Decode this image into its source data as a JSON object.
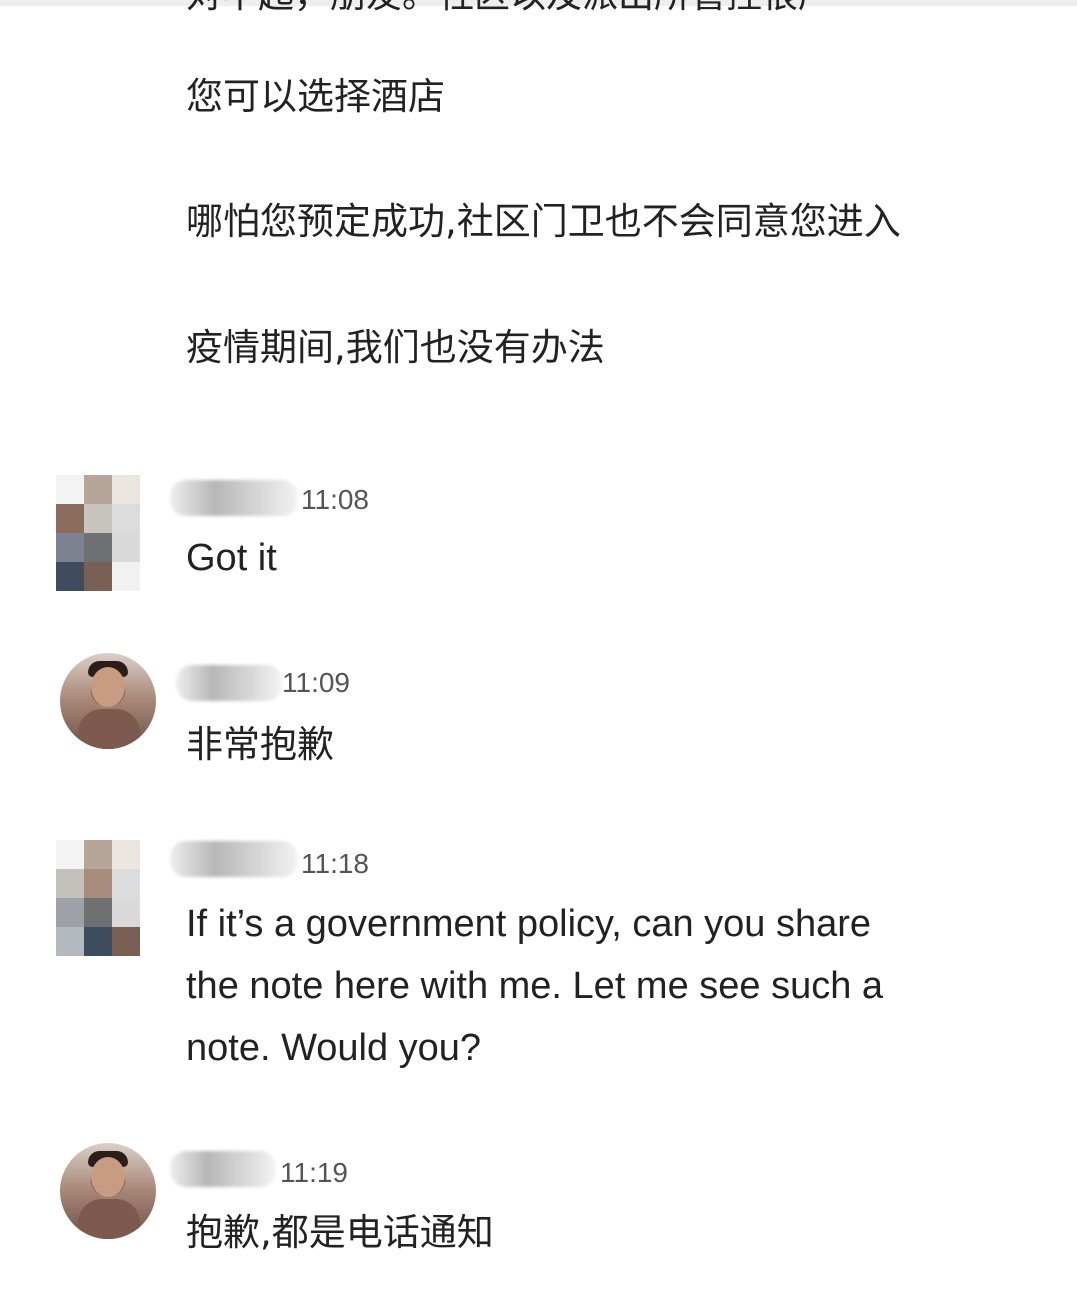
{
  "top_text": {
    "cut_line": "对不起，朋友。社区以及派出所管控很严",
    "line1": "您可以选择酒店",
    "line2": "哪怕您预定成功,社区门卫也不会同意您进入",
    "line3": "疫情期间,我们也没有办法"
  },
  "messages": [
    {
      "time": "11:08",
      "text": "Got it",
      "avatar_icon": "pixelated-avatar-icon"
    },
    {
      "time": "11:09",
      "text": "非常抱歉",
      "avatar_icon": "person-photo-avatar-icon"
    },
    {
      "time": "11:18",
      "lines": [
        "If it’s a government policy, can you share",
        "the note here with me. Let me see such a",
        "note. Would you?"
      ],
      "avatar_icon": "pixelated-avatar-icon"
    },
    {
      "time": "11:19",
      "text": "抱歉,都是电话通知",
      "avatar_icon": "person-photo-avatar-icon"
    }
  ],
  "colors": {
    "text": "#222222",
    "timestamp": "#555555",
    "background": "#ffffff"
  }
}
